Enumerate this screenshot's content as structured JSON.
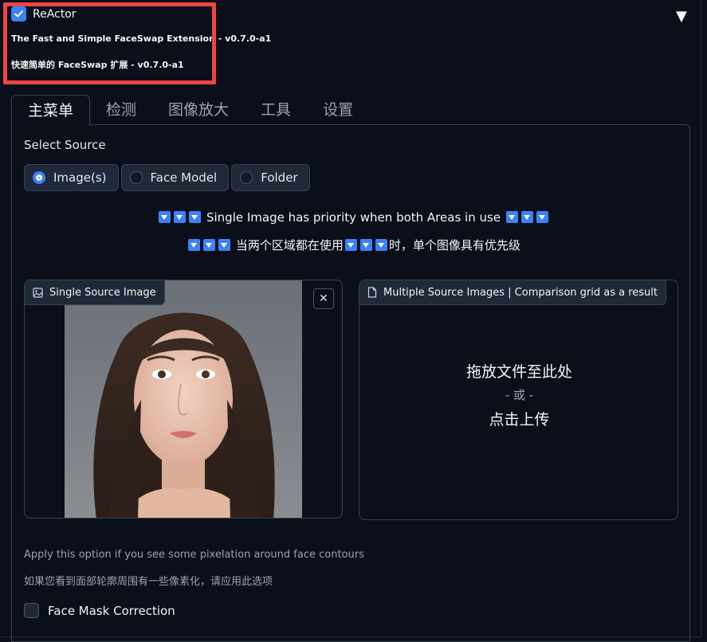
{
  "header": {
    "enabled": true,
    "title": "ReActor",
    "subtitle_en": "The Fast and Simple FaceSwap Extension - v0.7.0-a1",
    "subtitle_cn": "快速简单的 FaceSwap 扩展 - v0.7.0-a1",
    "collapse_icon": "triangle-down-icon"
  },
  "tabs": [
    {
      "label": "主菜单",
      "active": true
    },
    {
      "label": "检测",
      "active": false
    },
    {
      "label": "图像放大",
      "active": false
    },
    {
      "label": "工具",
      "active": false
    },
    {
      "label": "设置",
      "active": false
    }
  ],
  "source": {
    "label": "Select Source",
    "options": [
      {
        "label": "Image(s)",
        "selected": true
      },
      {
        "label": "Face Model",
        "selected": false
      },
      {
        "label": "Folder",
        "selected": false
      }
    ]
  },
  "priority": {
    "en": "Single Image has priority when both Areas in use",
    "cn_a": "当两个区域都在使用",
    "cn_b": "时，单个图像具有优先级"
  },
  "single_image": {
    "label": "Single Source Image",
    "label_icon": "image-icon",
    "close_icon": "close-icon",
    "close_symbol": "✕"
  },
  "multi_images": {
    "label": "Multiple Source Images | Comparison grid as a result",
    "label_icon": "file-icon",
    "drop_text": "拖放文件至此处",
    "or_text": "- 或 -",
    "click_text": "点击上传"
  },
  "notes": {
    "pixelation_en": "Apply this option if you see some pixelation around face contours",
    "pixelation_cn": "如果您看到面部轮廓周围有一些像素化，请应用此选项"
  },
  "face_mask": {
    "label": "Face Mask Correction",
    "checked": false
  },
  "colors": {
    "accent": "#3b82f6",
    "background": "#0b0f19",
    "highlight": "#ef4444"
  }
}
